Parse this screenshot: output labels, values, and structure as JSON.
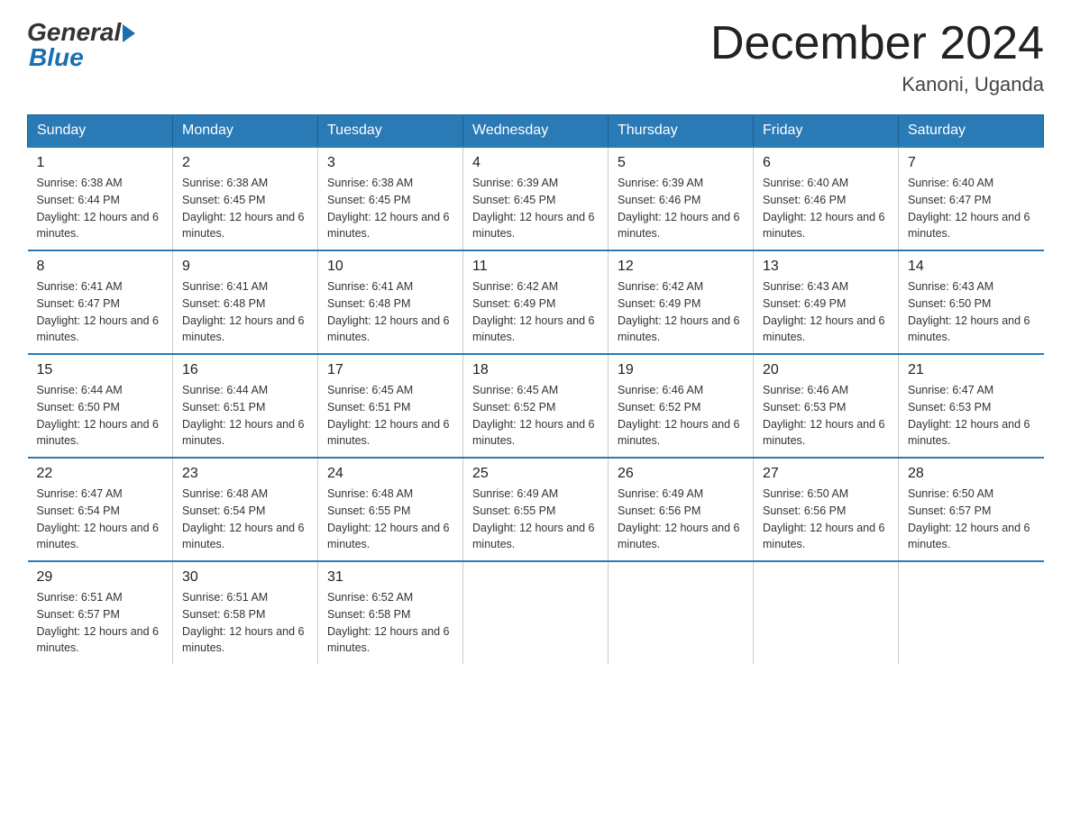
{
  "logo": {
    "general": "General",
    "blue": "Blue"
  },
  "title": "December 2024",
  "location": "Kanoni, Uganda",
  "days_of_week": [
    "Sunday",
    "Monday",
    "Tuesday",
    "Wednesday",
    "Thursday",
    "Friday",
    "Saturday"
  ],
  "weeks": [
    [
      {
        "day": "1",
        "sunrise": "6:38 AM",
        "sunset": "6:44 PM",
        "daylight": "12 hours and 6 minutes."
      },
      {
        "day": "2",
        "sunrise": "6:38 AM",
        "sunset": "6:45 PM",
        "daylight": "12 hours and 6 minutes."
      },
      {
        "day": "3",
        "sunrise": "6:38 AM",
        "sunset": "6:45 PM",
        "daylight": "12 hours and 6 minutes."
      },
      {
        "day": "4",
        "sunrise": "6:39 AM",
        "sunset": "6:45 PM",
        "daylight": "12 hours and 6 minutes."
      },
      {
        "day": "5",
        "sunrise": "6:39 AM",
        "sunset": "6:46 PM",
        "daylight": "12 hours and 6 minutes."
      },
      {
        "day": "6",
        "sunrise": "6:40 AM",
        "sunset": "6:46 PM",
        "daylight": "12 hours and 6 minutes."
      },
      {
        "day": "7",
        "sunrise": "6:40 AM",
        "sunset": "6:47 PM",
        "daylight": "12 hours and 6 minutes."
      }
    ],
    [
      {
        "day": "8",
        "sunrise": "6:41 AM",
        "sunset": "6:47 PM",
        "daylight": "12 hours and 6 minutes."
      },
      {
        "day": "9",
        "sunrise": "6:41 AM",
        "sunset": "6:48 PM",
        "daylight": "12 hours and 6 minutes."
      },
      {
        "day": "10",
        "sunrise": "6:41 AM",
        "sunset": "6:48 PM",
        "daylight": "12 hours and 6 minutes."
      },
      {
        "day": "11",
        "sunrise": "6:42 AM",
        "sunset": "6:49 PM",
        "daylight": "12 hours and 6 minutes."
      },
      {
        "day": "12",
        "sunrise": "6:42 AM",
        "sunset": "6:49 PM",
        "daylight": "12 hours and 6 minutes."
      },
      {
        "day": "13",
        "sunrise": "6:43 AM",
        "sunset": "6:49 PM",
        "daylight": "12 hours and 6 minutes."
      },
      {
        "day": "14",
        "sunrise": "6:43 AM",
        "sunset": "6:50 PM",
        "daylight": "12 hours and 6 minutes."
      }
    ],
    [
      {
        "day": "15",
        "sunrise": "6:44 AM",
        "sunset": "6:50 PM",
        "daylight": "12 hours and 6 minutes."
      },
      {
        "day": "16",
        "sunrise": "6:44 AM",
        "sunset": "6:51 PM",
        "daylight": "12 hours and 6 minutes."
      },
      {
        "day": "17",
        "sunrise": "6:45 AM",
        "sunset": "6:51 PM",
        "daylight": "12 hours and 6 minutes."
      },
      {
        "day": "18",
        "sunrise": "6:45 AM",
        "sunset": "6:52 PM",
        "daylight": "12 hours and 6 minutes."
      },
      {
        "day": "19",
        "sunrise": "6:46 AM",
        "sunset": "6:52 PM",
        "daylight": "12 hours and 6 minutes."
      },
      {
        "day": "20",
        "sunrise": "6:46 AM",
        "sunset": "6:53 PM",
        "daylight": "12 hours and 6 minutes."
      },
      {
        "day": "21",
        "sunrise": "6:47 AM",
        "sunset": "6:53 PM",
        "daylight": "12 hours and 6 minutes."
      }
    ],
    [
      {
        "day": "22",
        "sunrise": "6:47 AM",
        "sunset": "6:54 PM",
        "daylight": "12 hours and 6 minutes."
      },
      {
        "day": "23",
        "sunrise": "6:48 AM",
        "sunset": "6:54 PM",
        "daylight": "12 hours and 6 minutes."
      },
      {
        "day": "24",
        "sunrise": "6:48 AM",
        "sunset": "6:55 PM",
        "daylight": "12 hours and 6 minutes."
      },
      {
        "day": "25",
        "sunrise": "6:49 AM",
        "sunset": "6:55 PM",
        "daylight": "12 hours and 6 minutes."
      },
      {
        "day": "26",
        "sunrise": "6:49 AM",
        "sunset": "6:56 PM",
        "daylight": "12 hours and 6 minutes."
      },
      {
        "day": "27",
        "sunrise": "6:50 AM",
        "sunset": "6:56 PM",
        "daylight": "12 hours and 6 minutes."
      },
      {
        "day": "28",
        "sunrise": "6:50 AM",
        "sunset": "6:57 PM",
        "daylight": "12 hours and 6 minutes."
      }
    ],
    [
      {
        "day": "29",
        "sunrise": "6:51 AM",
        "sunset": "6:57 PM",
        "daylight": "12 hours and 6 minutes."
      },
      {
        "day": "30",
        "sunrise": "6:51 AM",
        "sunset": "6:58 PM",
        "daylight": "12 hours and 6 minutes."
      },
      {
        "day": "31",
        "sunrise": "6:52 AM",
        "sunset": "6:58 PM",
        "daylight": "12 hours and 6 minutes."
      },
      null,
      null,
      null,
      null
    ]
  ]
}
